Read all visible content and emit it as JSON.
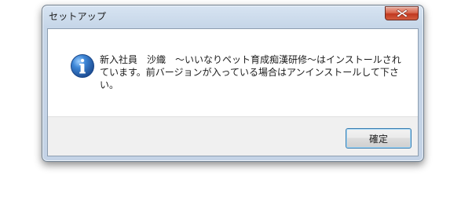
{
  "window": {
    "title": "セットアップ",
    "close_icon": "close-x-icon"
  },
  "message": {
    "icon": "information-icon",
    "text": "新入社員　沙織　～いいなりペット育成痴漢研修～はインストールされています。前バージョンが入っている場合はアンインストールして下さい。"
  },
  "buttons": {
    "ok_label": "確定"
  },
  "colors": {
    "title_bar": "#c6d6e8",
    "close_button": "#c0381f",
    "button_area": "#f0f0f0",
    "info_icon": "#2f6fbf",
    "ok_button_border": "#3c7fb1"
  }
}
